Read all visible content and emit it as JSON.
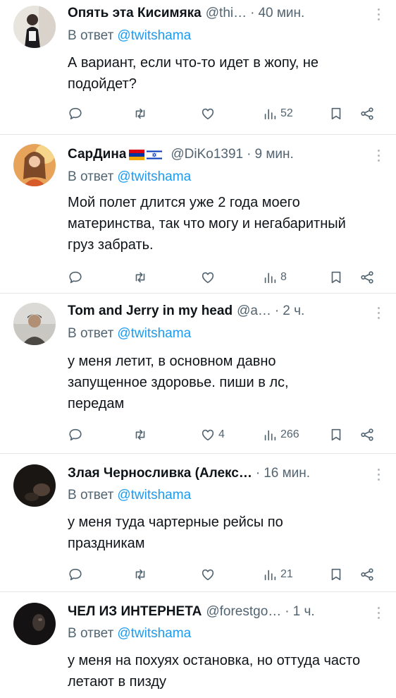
{
  "colors": {
    "accent": "#1d9bf0",
    "secondary_text": "#536471",
    "primary_text": "#0f1419",
    "divider": "#e4e7ea"
  },
  "tweets": [
    {
      "name": "Опять эта Кисимяка",
      "handle": "@thi…",
      "dot": "·",
      "time": "40 мин.",
      "reply_prefix": "В ответ",
      "reply_to": "@twitshama",
      "text": "А вариант, если что-то идет в жопу, не подойдет?",
      "likes": "",
      "views": "52"
    },
    {
      "name": "СарДина",
      "flags": [
        "armenia-flag-icon",
        "israel-flag-icon"
      ],
      "handle": "@DiKo1391",
      "dot": "·",
      "time": "9 мин.",
      "reply_prefix": "В ответ",
      "reply_to": "@twitshama",
      "text": "Мой полет длится уже 2 года моего материнства, так что могу и негабаритный груз забрать.",
      "likes": "",
      "views": "8"
    },
    {
      "name": "Tom and Jerry in my head",
      "handle": "@a…",
      "dot": "·",
      "time": "2 ч.",
      "reply_prefix": "В ответ",
      "reply_to": "@twitshama",
      "text": "у меня летит, в основном давно запущенное здоровье. пиши в лс, передам",
      "likes": "4",
      "views": "266"
    },
    {
      "name": "Злая Черносливка (Алекс…",
      "handle": "",
      "dot": "·",
      "time": "16 мин.",
      "reply_prefix": "В ответ",
      "reply_to": "@twitshama",
      "text": "у меня туда чартерные рейсы по праздникам",
      "likes": "",
      "views": "21"
    },
    {
      "name": "ЧЕЛ ИЗ ИНТЕРНЕТА",
      "handle": "@forestgo…",
      "dot": "·",
      "time": "1 ч.",
      "reply_prefix": "В ответ",
      "reply_to": "@twitshama",
      "text": "у меня на похуях остановка, но оттуда часто летают в пизду",
      "likes": "",
      "views": ""
    }
  ]
}
